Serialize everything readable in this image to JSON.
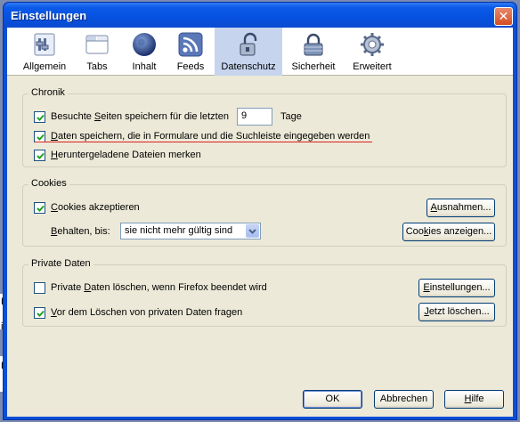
{
  "window": {
    "title": "Einstellungen",
    "close_icon": "close-icon"
  },
  "toolbar": {
    "items": [
      {
        "label": "Allgemein",
        "icon": "general-switch-icon"
      },
      {
        "label": "Tabs",
        "icon": "tabs-window-icon"
      },
      {
        "label": "Inhalt",
        "icon": "globe-icon"
      },
      {
        "label": "Feeds",
        "icon": "feed-icon"
      },
      {
        "label": "Datenschutz",
        "icon": "lock-icon"
      },
      {
        "label": "Sicherheit",
        "icon": "security-padlock-icon"
      },
      {
        "label": "Erweitert",
        "icon": "gear-icon"
      }
    ],
    "selected": "Datenschutz"
  },
  "chronik": {
    "legend": "Chronik",
    "history": {
      "label_pre": "Besuchte ",
      "label_key": "S",
      "label_post": "eiten speichern für die letzten",
      "checked": true,
      "days_value": "9",
      "days_unit": "Tage"
    },
    "forms": {
      "label_key": "D",
      "label_post": "aten speichern, die in Formulare und die Suchleiste eingegeben werden",
      "checked": true
    },
    "downloads": {
      "label_key": "H",
      "label_post": "eruntergeladene Dateien merken",
      "checked": true
    }
  },
  "cookies": {
    "legend": "Cookies",
    "accept": {
      "label_key": "C",
      "label_post": "ookies akzeptieren",
      "checked": true
    },
    "exceptions_button": {
      "key": "A",
      "rest": "usnahmen..."
    },
    "keep_label_key": "B",
    "keep_label_post": "ehalten, bis:",
    "keep_select": "sie nicht mehr gültig sind",
    "show_button": {
      "pre": "Coo",
      "key": "k",
      "rest": "ies anzeigen..."
    }
  },
  "private": {
    "legend": "Private Daten",
    "clear_on_exit": {
      "label_pre": "Private ",
      "label_key": "D",
      "label_post": "aten löschen, wenn Firefox beendet wird",
      "checked": false
    },
    "settings_button": {
      "key": "E",
      "rest": "instellungen..."
    },
    "ask_before": {
      "label_key": "V",
      "label_post": "or dem Löschen von privaten Daten fragen",
      "checked": true
    },
    "clear_now_button": {
      "key": "J",
      "rest": "etzt löschen..."
    }
  },
  "buttons": {
    "ok": "OK",
    "cancel": "Abbrechen",
    "help_key": "H",
    "help_rest": "ilfe"
  },
  "background_fragments": [
    "H",
    "i",
    "H"
  ],
  "colors": {
    "title_blue": "#0a4fd6",
    "dialog_bg": "#ece9d8",
    "selected_tab": "#c6d4ee",
    "annotation_red": "#e02020"
  }
}
